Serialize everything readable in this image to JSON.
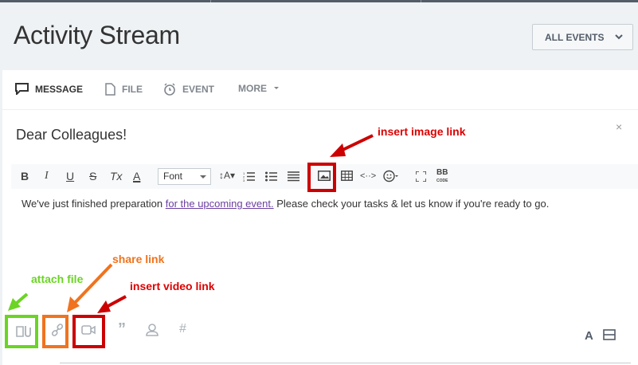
{
  "page": {
    "title": "Activity Stream"
  },
  "filter": {
    "label": "ALL EVENTS"
  },
  "tabs": [
    {
      "label": "MESSAGE"
    },
    {
      "label": "FILE"
    },
    {
      "label": "EVENT"
    },
    {
      "label": "MORE"
    }
  ],
  "editor": {
    "subject": "Dear Colleagues!",
    "close_symbol": "×",
    "font_select": "Font",
    "body_before": "We've just finished preparation ",
    "body_link": "for the upcoming event.",
    "body_after": " Please check your tasks & let us know if you're ready to go."
  },
  "toolbar": {
    "bold": "B",
    "italic": "I",
    "underline": "U",
    "strike": "S",
    "clear": "Tx",
    "color": "A",
    "size": "A",
    "code_view": "<··>",
    "bb": "BB",
    "bb_sub": "CODE"
  },
  "bottom": {
    "font_toggle": "A"
  },
  "annotations": {
    "insert_image": "insert image link",
    "share": "share  link",
    "attach": "attach file",
    "insert_video": "insert video link"
  },
  "colors": {
    "annotation_red": "#d00000",
    "annotation_orange": "#f0731e",
    "annotation_green": "#6bd424"
  }
}
